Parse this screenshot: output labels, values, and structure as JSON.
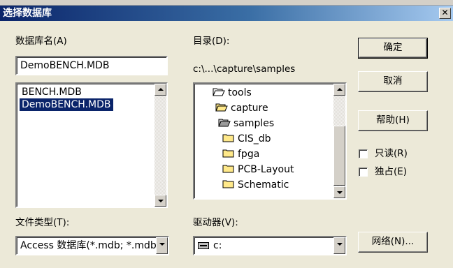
{
  "window": {
    "title": "选择数据库",
    "close_glyph": "✕"
  },
  "db_name": {
    "label": "数据库名(A)",
    "value": "DemoBENCH.MDB"
  },
  "db_list": {
    "items": [
      "BENCH.MDB",
      "DemoBENCH.MDB"
    ],
    "selected": "DemoBENCH.MDB"
  },
  "directory": {
    "label": "目录(D):",
    "path": "c:\\...\\capture\\samples"
  },
  "folders": [
    "tools",
    "capture",
    "samples",
    "CIS_db",
    "fpga",
    "PCB-Layout",
    "Schematic"
  ],
  "file_type": {
    "label": "文件类型(T):",
    "value": "Access 数据库(*.mdb; *.mdb)"
  },
  "drive": {
    "label": "驱动器(V):",
    "value": "c:",
    "icon": "drive-icon"
  },
  "buttons": {
    "ok": "确定",
    "cancel": "取消",
    "help": "帮助(H)",
    "network": "网络(N)..."
  },
  "options": {
    "readonly": "只读(R)",
    "exclusive": "独占(E)"
  },
  "colors": {
    "title_start": "#0a246a",
    "selection": "#0a246a",
    "face": "#ece9d8"
  }
}
